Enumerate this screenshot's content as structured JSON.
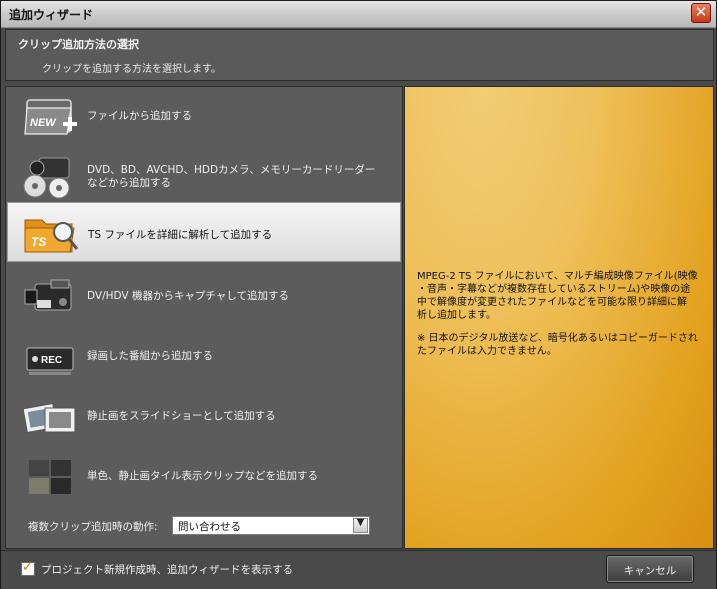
{
  "window": {
    "title": "追加ウィザード"
  },
  "header": {
    "title": "クリップ追加方法の選択",
    "subtitle": "クリップを追加する方法を選択します。"
  },
  "options": [
    {
      "icon": "new-file-icon",
      "line1": "ファイルから追加する",
      "line2": ""
    },
    {
      "icon": "disc-camera-icon",
      "line1": "DVD、BD、AVCHD、HDDカメラ、メモリーカードリーダー",
      "line2": "などから追加する"
    },
    {
      "icon": "ts-folder-search-icon",
      "line1": "TS ファイルを詳細に解析して追加する",
      "line2": ""
    },
    {
      "icon": "camcorder-icon",
      "line1": "DV/HDV 機器からキャプチャして追加する",
      "line2": ""
    },
    {
      "icon": "rec-icon",
      "line1": "録画した番組から追加する",
      "line2": ""
    },
    {
      "icon": "slideshow-icon",
      "line1": "静止画をスライドショーとして追加する",
      "line2": ""
    },
    {
      "icon": "color-tile-icon",
      "line1": "単色、静止画タイル表示クリップなどを追加する",
      "line2": ""
    }
  ],
  "selected_option": "TS ファイルを詳細に解析して追加する",
  "dropdown": {
    "label": "複数クリップ追加時の動作:",
    "value": "問い合わせる"
  },
  "description": {
    "lines1": [
      "MPEG-2 TS ファイルにおいて、マルチ編成映像ファイル(映像",
      "・音声・字幕などが複数存在しているストリーム)や映像の途",
      "中で解像度が変更されたファイルなどを可能な限り詳細に解",
      "析し追加します。"
    ],
    "lines2": [
      "※ 日本のデジタル放送など、暗号化あるいはコピーガードされ",
      "たファイルは入力できません。"
    ]
  },
  "footer": {
    "checkbox_checked": true,
    "checkbox_label": "プロジェクト新規作成時、追加ウィザードを表示する",
    "cancel_label": "キャンセル"
  }
}
